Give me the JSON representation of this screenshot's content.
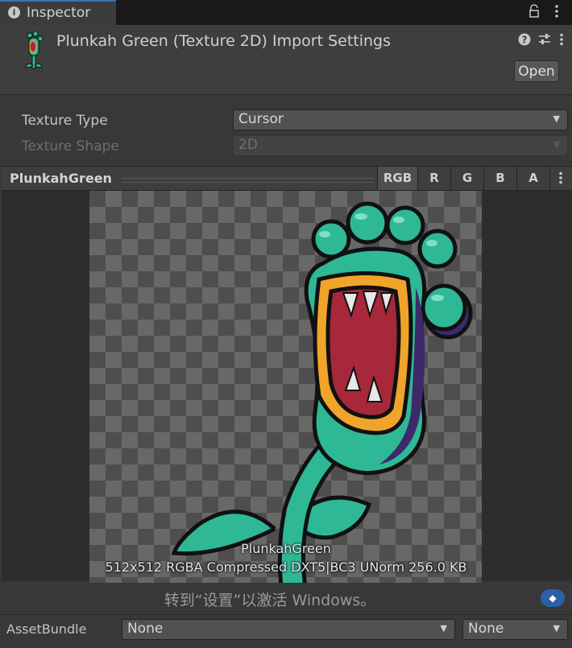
{
  "window": {
    "tab_label": "Inspector",
    "tab_icon": "info-icon",
    "lock_icon": "lock-icon",
    "menu_icon": "kebab-menu-icon"
  },
  "header": {
    "title": "Plunkah Green (Texture 2D) Import Settings",
    "open_label": "Open",
    "icons": [
      "help-icon",
      "presets-icon",
      "kebab-menu-icon"
    ]
  },
  "settings": {
    "texture_type": {
      "label": "Texture Type",
      "value": "Cursor"
    },
    "texture_shape": {
      "label": "Texture Shape",
      "value": "2D",
      "disabled": true
    }
  },
  "preview": {
    "title": "PlunkahGreen",
    "channels": [
      "RGB",
      "R",
      "G",
      "B",
      "A"
    ],
    "active_channel": "RGB",
    "image_name": "PlunkahGreen",
    "info": "512x512  RGBA Compressed DXT5|BC3 UNorm   256.0 KB"
  },
  "watermark": {
    "text": "转到“设置”以激活 Windows。"
  },
  "asset_bundle": {
    "label": "AssetBundle",
    "name_value": "None",
    "variant_value": "None"
  },
  "colors": {
    "plant_green": "#2fb896",
    "plant_outline": "#111111",
    "mouth_red": "#a7283a",
    "lip_orange": "#f0a52a",
    "shadow_purple": "#3d2a6a"
  }
}
